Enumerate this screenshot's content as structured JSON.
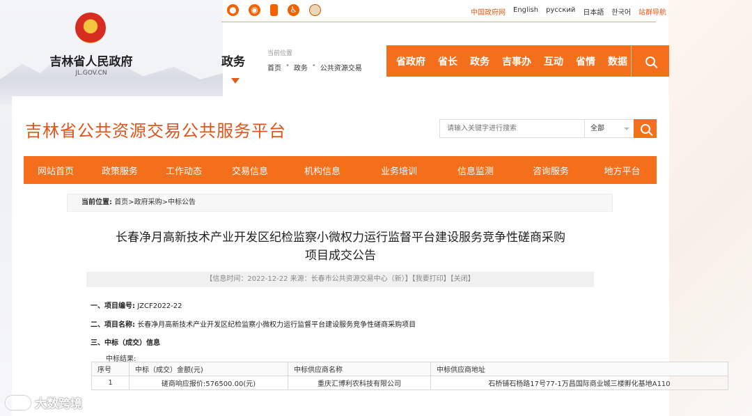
{
  "gov": {
    "name": "吉林省人民政府",
    "domain": "JL.GOV.CN"
  },
  "top_icons": [
    "wechat-icon",
    "weibo-icon",
    "mobile-icon",
    "accessibility-icon",
    "mascot-icon"
  ],
  "top_links": [
    {
      "label": "中国政府网",
      "accent": true
    },
    {
      "label": "English",
      "accent": false
    },
    {
      "label": "русский",
      "accent": false
    },
    {
      "label": "日本語",
      "accent": false
    },
    {
      "label": "한국어",
      "accent": false
    },
    {
      "label": "站群导航",
      "accent": true
    }
  ],
  "section": {
    "label": "政务",
    "location_title": "当前位置",
    "crumbs": [
      "首页",
      "政务",
      "公共资源交易"
    ]
  },
  "gov_nav": [
    "省政府",
    "省长",
    "政务",
    "吉事办",
    "互动",
    "省情",
    "数据"
  ],
  "platform": {
    "title": "吉林省公共资源交易公共服务平台",
    "search_placeholder": "请输入关键字进行搜索",
    "search_scope": "全部"
  },
  "main_nav": [
    "网站首页",
    "政策服务",
    "工作动态",
    "交易信息",
    "机构信息",
    "业务培训",
    "信息监测",
    "咨询服务",
    "地方平台"
  ],
  "breadcrumb": {
    "label": "当前位置:",
    "path": "首页>政府采购>中标公告"
  },
  "article": {
    "title_line1": "长春净月高新技术产业开发区纪检监察小微权力运行监督平台建设服务竞争性磋商采购",
    "title_line2": "项目成交公告",
    "meta": "【信息时间：2022-12-22 来源：长春市公共资源交易中心（新）】【我要打印】【关闭】",
    "fields": [
      {
        "label": "一、项目编号:",
        "value": "JZCF2022-22"
      },
      {
        "label": "二、项目名称:",
        "value": "长春净月高新技术产业开发区纪检监察小微权力运行监督平台建设服务竞争性磋商采购项目"
      },
      {
        "label": "三、中标（成交）信息",
        "value": ""
      }
    ],
    "result_label": "中标结果:",
    "table": {
      "headers": [
        "序号",
        "中标（成交）金额(元)",
        "中标供应商名称",
        "中标供应商地址"
      ],
      "rows": [
        [
          "1",
          "磋商响应报价:576500.00(元)",
          "重庆汇博利农科技有限公司",
          "石桥铺石杨路17号77-1万昌国际商业城三楼孵化基地A110"
        ]
      ]
    }
  },
  "watermark": "大数跨境",
  "colors": {
    "accent": "#f46f1c",
    "title_orange": "#e0541a"
  }
}
